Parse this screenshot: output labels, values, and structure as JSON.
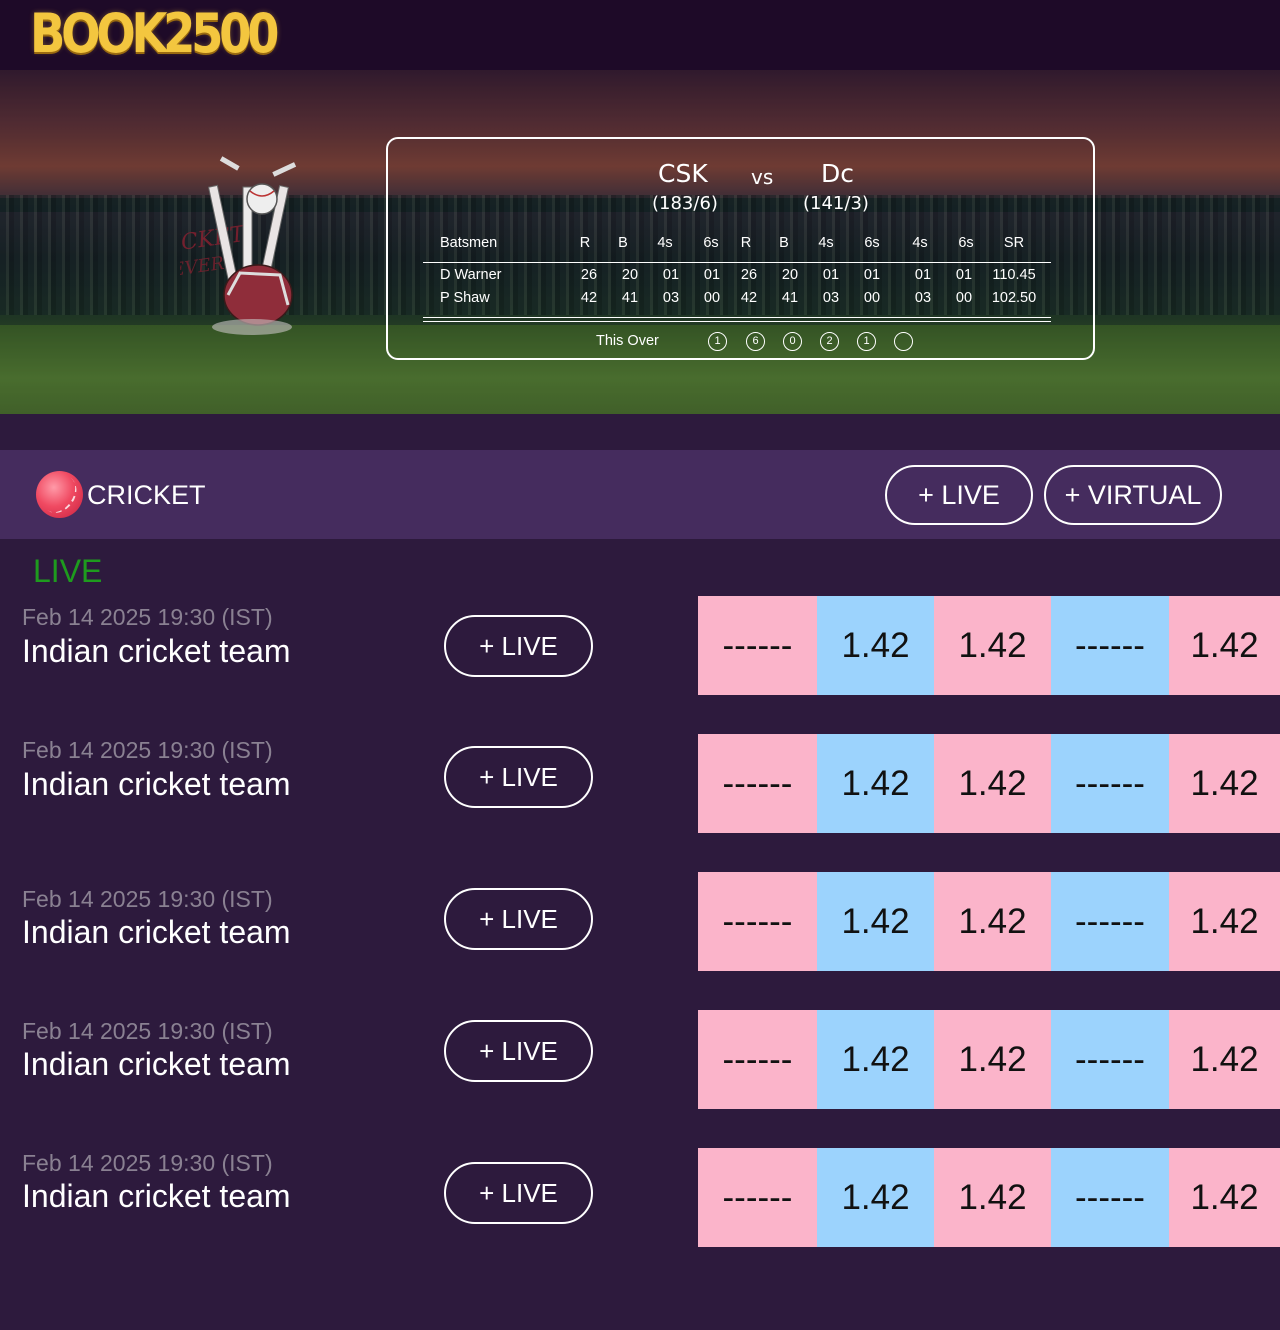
{
  "brand": {
    "logo": "BOOK2500"
  },
  "hero": {
    "image_label": "CRICKET FEVER",
    "team1": {
      "name": "CSK",
      "score": "(183/6)"
    },
    "vs": "vs",
    "team2": {
      "name": "Dc",
      "score": "(141/3)"
    },
    "headers": [
      "Batsmen",
      "R",
      "B",
      "4s",
      "6s",
      "R",
      "B",
      "4s",
      "6s",
      "4s",
      "6s",
      "SR"
    ],
    "batsmen": [
      {
        "name": "D Warner",
        "stats": [
          "26",
          "20",
          "01",
          "01",
          "26",
          "20",
          "01",
          "01",
          "01",
          "01",
          "110.45"
        ]
      },
      {
        "name": "P Shaw",
        "stats": [
          "42",
          "41",
          "03",
          "00",
          "42",
          "41",
          "03",
          "00",
          "03",
          "00",
          "102.50"
        ]
      }
    ],
    "this_over_label": "This Over",
    "this_over": [
      "1",
      "6",
      "0",
      "2",
      "1",
      ""
    ]
  },
  "sport": {
    "title": "CRICKET",
    "live_button": "+ LIVE",
    "virtual_button": "+ VIRTUAL"
  },
  "live_heading": "LIVE",
  "matches": [
    {
      "date": "Feb 14 2025 19:30 (IST)",
      "team": "Indian cricket team",
      "button": "+ LIVE",
      "odds": [
        "------",
        "1.42",
        "1.42",
        "------",
        "1.42"
      ]
    },
    {
      "date": "Feb 14 2025 19:30 (IST)",
      "team": "Indian cricket team",
      "button": "+ LIVE",
      "odds": [
        "------",
        "1.42",
        "1.42",
        "------",
        "1.42"
      ]
    },
    {
      "date": "Feb 14 2025 19:30 (IST)",
      "team": "Indian cricket team",
      "button": "+ LIVE",
      "odds": [
        "------",
        "1.42",
        "1.42",
        "------",
        "1.42"
      ]
    },
    {
      "date": "Feb 14 2025 19:30 (IST)",
      "team": "Indian cricket team",
      "button": "+ LIVE",
      "odds": [
        "------",
        "1.42",
        "1.42",
        "------",
        "1.42"
      ]
    },
    {
      "date": "Feb 14 2025 19:30 (IST)",
      "team": "Indian cricket team",
      "button": "+ LIVE",
      "odds": [
        "------",
        "1.42",
        "1.42",
        "------",
        "1.42"
      ]
    }
  ],
  "colors": {
    "back": "#9cd3fd",
    "lay": "#fbb4ca",
    "live": "#1e9b1e",
    "logo": "#f3c63f"
  }
}
